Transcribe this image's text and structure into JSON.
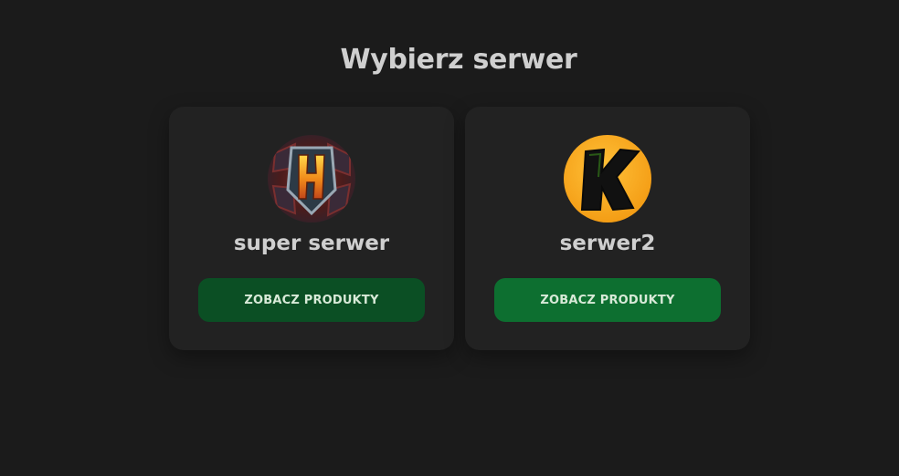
{
  "page": {
    "title": "Wybierz serwer"
  },
  "servers": [
    {
      "name": "super serwer",
      "button_label": "ZOBACZ PRODUKTY",
      "logo_icon": "h-emblem-icon"
    },
    {
      "name": "serwer2",
      "button_label": "ZOBACZ PRODUKTY",
      "logo_icon": "k-emblem-icon"
    }
  ],
  "colors": {
    "background": "#1b1b1b",
    "card": "#222222",
    "button_primary": "#0d6f30",
    "button_hover_state": "#0b4f24",
    "text": "#cfcfcf"
  }
}
